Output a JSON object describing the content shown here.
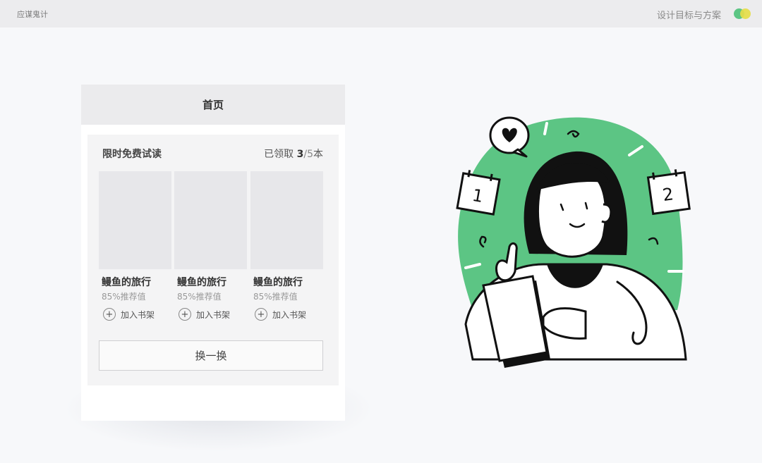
{
  "topbar": {
    "brand": "应谋鬼计",
    "topic": "设计目标与方案",
    "colors": [
      "#5cc584",
      "#e5dd49"
    ]
  },
  "phone": {
    "header_title": "首页",
    "card": {
      "title": "限时免费试读",
      "count_prefix": "已领取",
      "count_value": "3",
      "count_sep": "/",
      "count_total": "5",
      "count_suffix": "本",
      "books": [
        {
          "title": "鳗鱼的旅行",
          "rating": "85%推荐值",
          "add_label": "加入书架"
        },
        {
          "title": "鳗鱼的旅行",
          "rating": "85%推荐值",
          "add_label": "加入书架"
        },
        {
          "title": "鳗鱼的旅行",
          "rating": "85%推荐值",
          "add_label": "加入书架"
        }
      ],
      "swap_label": "换一换"
    }
  },
  "illustration": {
    "calendar_left": "1",
    "calendar_right": "2",
    "accent_color": "#5cc584"
  }
}
